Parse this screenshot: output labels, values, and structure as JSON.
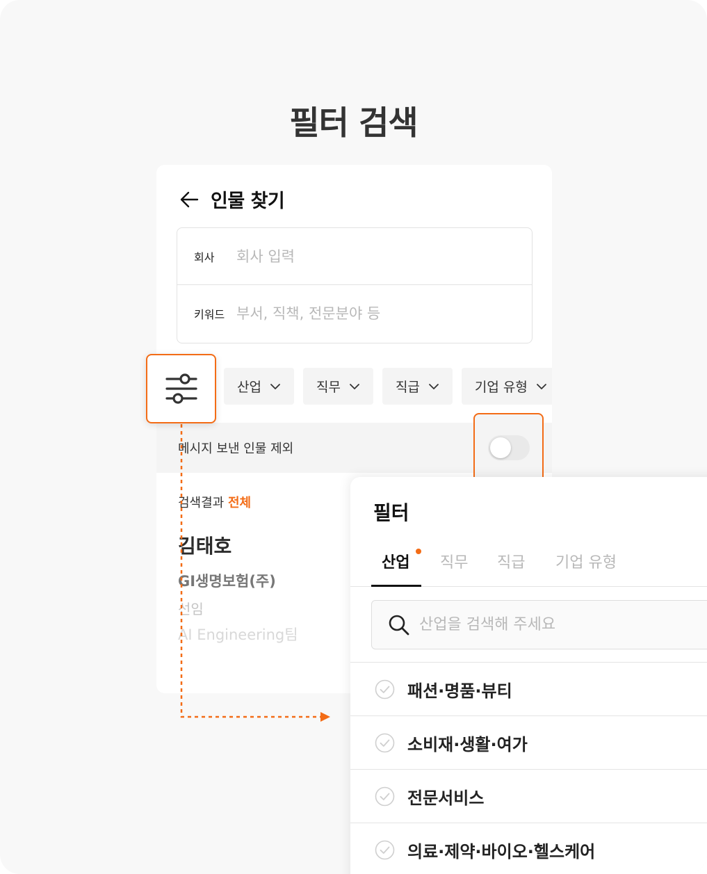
{
  "headline": "필터 검색",
  "people_search": {
    "title": "인물 찾기",
    "form": {
      "company_label": "회사",
      "company_placeholder": "회사 입력",
      "company_value": "",
      "keyword_label": "키워드",
      "keyword_placeholder": "부서, 직책, 전문분야 등",
      "keyword_value": ""
    },
    "chips": [
      "산업",
      "직무",
      "직급",
      "기업 유형"
    ],
    "exclude_messaged_label": "메시지 보낸 인물 제외",
    "exclude_messaged_on": false,
    "results_label": "검색결과",
    "results_scope": "전체",
    "person": {
      "name": "김태호",
      "company": "GI생명보험(주)",
      "rank": "선임",
      "team": "AI Engineering팀"
    }
  },
  "filter_panel": {
    "title": "필터",
    "tabs": [
      "산업",
      "직무",
      "직급",
      "기업 유형"
    ],
    "active_tab": "산업",
    "search_placeholder": "산업을 검색해 주세요",
    "search_value": "",
    "industries": [
      "패션·명품·뷰티",
      "소비재·생활·여가",
      "전문서비스",
      "의료·제약·바이오·헬스케어"
    ]
  },
  "colors": {
    "accent": "#f36c16",
    "background": "#f8f8f8",
    "card": "#ffffff",
    "chip": "#f4f4f4"
  },
  "icons": [
    "back-arrow-icon",
    "chevron-down-icon",
    "filter-sliders-icon",
    "search-icon",
    "check-circle-icon",
    "arrow-right-icon"
  ]
}
